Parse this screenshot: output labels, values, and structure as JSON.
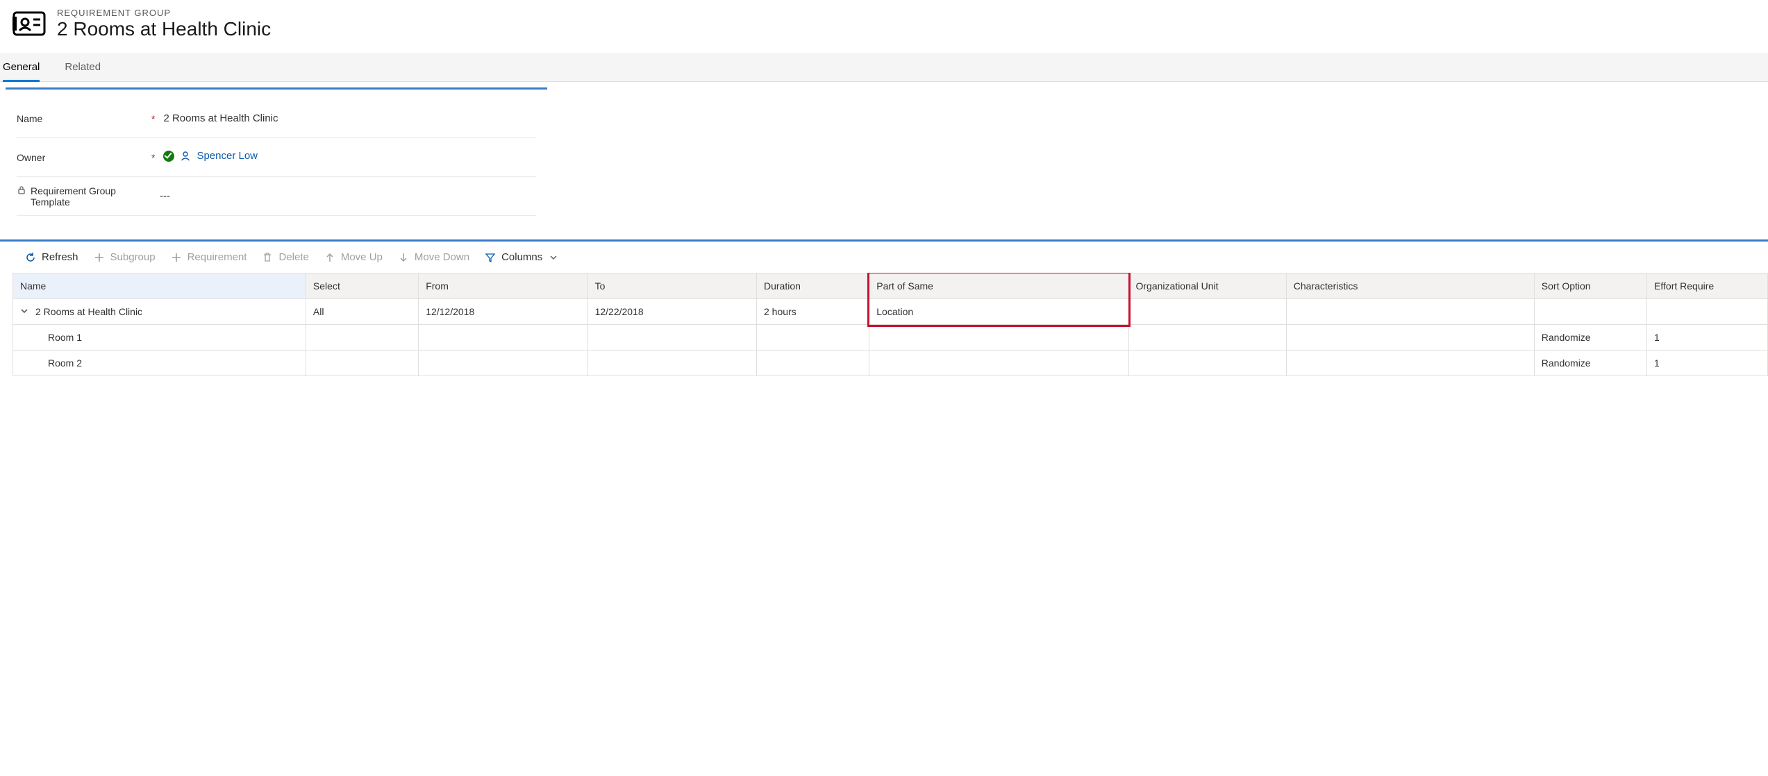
{
  "header": {
    "type_label": "REQUIREMENT GROUP",
    "title": "2 Rooms at Health Clinic"
  },
  "tabs": {
    "general": "General",
    "related": "Related"
  },
  "form": {
    "name_label": "Name",
    "name_value": "2 Rooms at Health Clinic",
    "owner_label": "Owner",
    "owner_value": "Spencer Low",
    "template_label": "Requirement Group Template",
    "template_value": "---"
  },
  "grid_toolbar": {
    "refresh": "Refresh",
    "subgroup": "Subgroup",
    "requirement": "Requirement",
    "delete": "Delete",
    "moveup": "Move Up",
    "movedown": "Move Down",
    "columns": "Columns"
  },
  "grid": {
    "headers": {
      "name": "Name",
      "select": "Select",
      "from": "From",
      "to": "To",
      "duration": "Duration",
      "partofsame": "Part of Same",
      "orgunit": "Organizational Unit",
      "characteristics": "Characteristics",
      "sortoption": "Sort Option",
      "effort": "Effort Require"
    },
    "rows": [
      {
        "name": "2 Rooms at Health Clinic",
        "select": "All",
        "from": "12/12/2018",
        "to": "12/22/2018",
        "duration": "2 hours",
        "partofsame": "Location",
        "orgunit": "",
        "characteristics": "",
        "sortoption": "",
        "effort": "",
        "expandable": true,
        "indent": 0
      },
      {
        "name": "Room 1",
        "select": "",
        "from": "",
        "to": "",
        "duration": "",
        "partofsame": "",
        "orgunit": "",
        "characteristics": "",
        "sortoption": "Randomize",
        "effort": "1",
        "expandable": false,
        "indent": 1
      },
      {
        "name": "Room 2",
        "select": "",
        "from": "",
        "to": "",
        "duration": "",
        "partofsame": "",
        "orgunit": "",
        "characteristics": "",
        "sortoption": "Randomize",
        "effort": "1",
        "expandable": false,
        "indent": 1
      }
    ]
  }
}
